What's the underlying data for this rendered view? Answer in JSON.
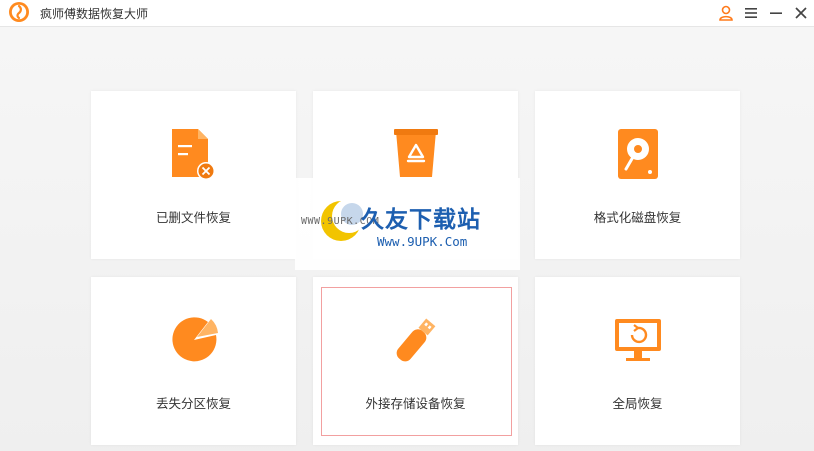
{
  "app": {
    "title": "疯师傅数据恢复大师"
  },
  "titlebar_buttons": [
    {
      "name": "user-icon"
    },
    {
      "name": "menu-icon"
    },
    {
      "name": "minimize-icon"
    },
    {
      "name": "close-icon"
    }
  ],
  "cards": [
    {
      "label": "已删文件恢复",
      "icon": "deleted-file-icon"
    },
    {
      "label": "",
      "icon": "recycle-bin-icon"
    },
    {
      "label": "格式化磁盘恢复",
      "icon": "format-disk-icon"
    },
    {
      "label": "丢失分区恢复",
      "icon": "lost-partition-icon"
    },
    {
      "label": "外接存储设备恢复",
      "icon": "usb-drive-icon",
      "selected": true
    },
    {
      "label": "全局恢复",
      "icon": "monitor-restore-icon"
    }
  ],
  "watermark": {
    "www": "WWW.9UPK.COM",
    "title": "久友下载站",
    "url": "Www.9UPK.Com"
  },
  "colors": {
    "accent": "#ff8a1f",
    "accent_dark": "#f07a10",
    "selection_border": "#f2a0a0",
    "watermark_blue": "#1d5fb0"
  }
}
